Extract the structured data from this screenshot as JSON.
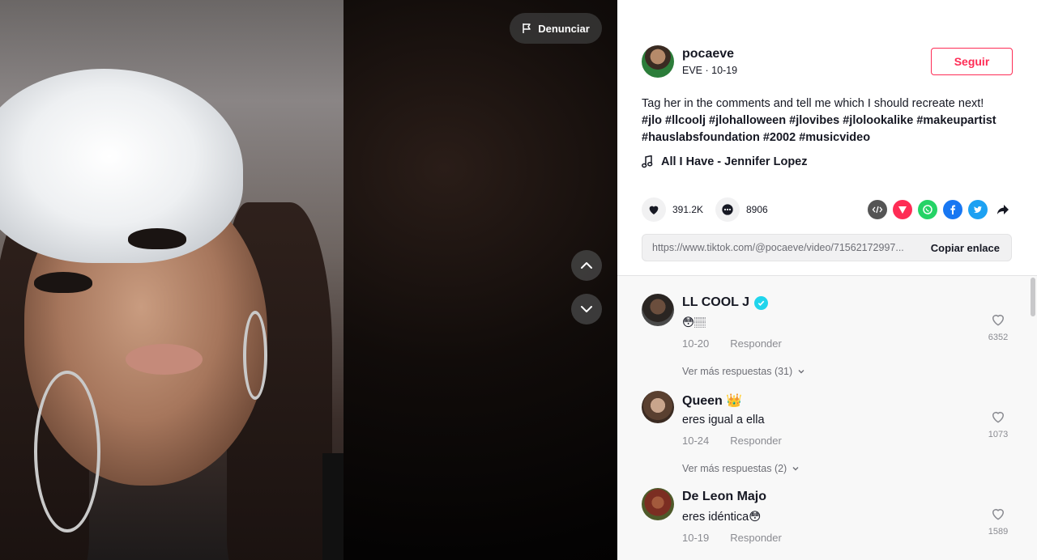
{
  "video": {
    "report_label": "Denunciar"
  },
  "author": {
    "username": "pocaeve",
    "subline": "EVE · 10-19",
    "follow_label": "Seguir"
  },
  "description": {
    "text": "Tag her in the comments and tell me which I should recreate next!",
    "hashtags": [
      "#jlo",
      "#llcoolj",
      "#jlohalloween",
      "#jlovibes",
      "#jlolookalike",
      "#makeupartist",
      "#hauslabsfoundation",
      "#2002",
      "#musicvideo"
    ]
  },
  "music": {
    "title": "All I Have - Jennifer Lopez"
  },
  "stats": {
    "likes": "391.2K",
    "comments": "8906"
  },
  "share": {
    "icons": [
      "embed-icon",
      "send-icon",
      "whatsapp-icon",
      "facebook-icon",
      "twitter-icon",
      "share-arrow-icon"
    ],
    "colors": {
      "embed": "#555555",
      "send": "#fe2c55",
      "whatsapp": "#25d366",
      "facebook": "#1877f2",
      "twitter": "#1da1f2"
    }
  },
  "link": {
    "url": "https://www.tiktok.com/@pocaeve/video/71562172997...",
    "copy_label": "Copiar enlace"
  },
  "comments": [
    {
      "name": "LL COOL J",
      "verified": true,
      "text": "😳🏽",
      "date": "10-20",
      "reply_label": "Responder",
      "likes": "6352",
      "more_replies": "Ver más respuestas (31)"
    },
    {
      "name": "Queen 👑",
      "verified": false,
      "text": "eres igual a ella",
      "date": "10-24",
      "reply_label": "Responder",
      "likes": "1073",
      "more_replies": "Ver más respuestas (2)"
    },
    {
      "name": "De Leon Majo",
      "verified": false,
      "text": "eres idéntica😳",
      "date": "10-19",
      "reply_label": "Responder",
      "likes": "1589"
    }
  ],
  "colors": {
    "accent": "#fe2c55",
    "verified": "#20d5ec",
    "text": "#161823",
    "muted": "#8a8b91"
  }
}
